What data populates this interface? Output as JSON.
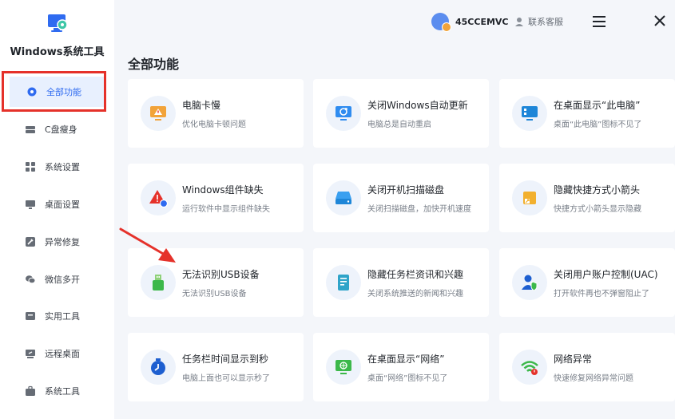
{
  "app": {
    "title": "Windows系统工具"
  },
  "sidebar": {
    "items": [
      {
        "label": "全部功能",
        "icon": "gear-icon"
      },
      {
        "label": "C盘瘦身",
        "icon": "drive-icon"
      },
      {
        "label": "系统设置",
        "icon": "grid-icon"
      },
      {
        "label": "桌面设置",
        "icon": "monitor-icon"
      },
      {
        "label": "异常修复",
        "icon": "tool-icon"
      },
      {
        "label": "微信多开",
        "icon": "chat-icon"
      },
      {
        "label": "实用工具",
        "icon": "box-icon"
      },
      {
        "label": "远程桌面",
        "icon": "remote-icon"
      },
      {
        "label": "系统工具",
        "icon": "briefcase-icon"
      }
    ]
  },
  "header": {
    "user": "45CCEMVC",
    "support": "联系客服"
  },
  "main": {
    "title": "全部功能",
    "cards": [
      {
        "title": "电脑卡慢",
        "desc": "优化电脑卡顿问题",
        "icon": "warning-monitor-icon"
      },
      {
        "title": "关闭Windows自动更新",
        "desc": "电脑总是自动重启",
        "icon": "update-icon"
      },
      {
        "title": "在桌面显示“此电脑”",
        "desc": "桌面“此电脑”图标不见了",
        "icon": "computer-icon"
      },
      {
        "title": "Windows组件缺失",
        "desc": "运行软件中显示组件缺失",
        "icon": "component-warning-icon"
      },
      {
        "title": "关闭开机扫描磁盘",
        "desc": "关闭扫描磁盘，加快开机速度",
        "icon": "disk-icon"
      },
      {
        "title": "隐藏快捷方式小箭头",
        "desc": "快捷方式小箭头显示隐藏",
        "icon": "shortcut-icon"
      },
      {
        "title": "无法识别USB设备",
        "desc": "无法识别USB设备",
        "icon": "usb-icon"
      },
      {
        "title": "隐藏任务栏资讯和兴趣",
        "desc": "关闭系统推送的新闻和兴趣",
        "icon": "news-icon"
      },
      {
        "title": "关闭用户账户控制(UAC)",
        "desc": "打开软件再也不弹窗阻止了",
        "icon": "uac-icon"
      },
      {
        "title": "任务栏时间显示到秒",
        "desc": "电脑上面也可以显示秒了",
        "icon": "clock-icon"
      },
      {
        "title": "在桌面显示“网络”",
        "desc": "桌面“网络”图标不见了",
        "icon": "network-monitor-icon"
      },
      {
        "title": "网络异常",
        "desc": "快速修复网络异常问题",
        "icon": "wifi-icon"
      }
    ]
  },
  "colors": {
    "accent": "#2f6bf0",
    "highlight": "#e5312a",
    "background": "#f4f6fa"
  }
}
